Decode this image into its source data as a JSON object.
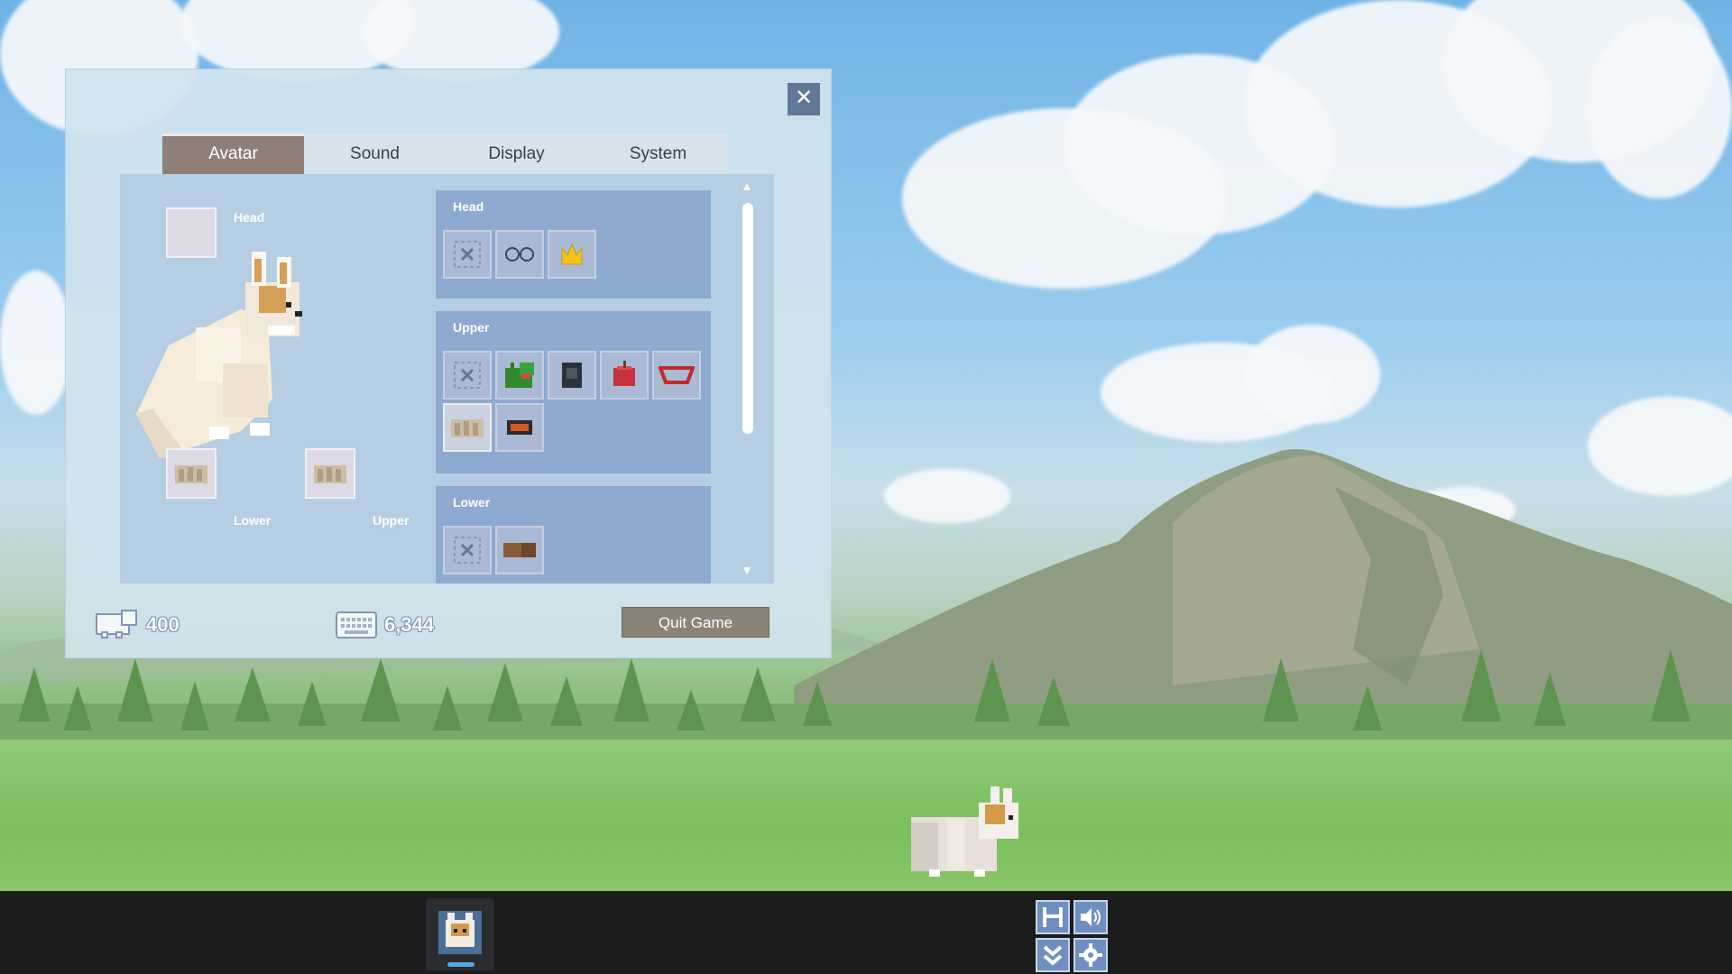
{
  "window": {
    "close_label": "✕"
  },
  "tabs": [
    {
      "label": "Avatar",
      "active": true
    },
    {
      "label": "Sound",
      "active": false
    },
    {
      "label": "Display",
      "active": false
    },
    {
      "label": "System",
      "active": false
    }
  ],
  "preview": {
    "head_label": "Head",
    "lower_label": "Lower",
    "upper_label": "Upper"
  },
  "categories": {
    "head": {
      "title": "Head",
      "items": [
        "none-icon",
        "glasses-icon",
        "crown-icon"
      ]
    },
    "upper": {
      "title": "Upper",
      "items": [
        "none-icon",
        "dino-hood-icon",
        "dark-hood-icon",
        "apple-icon",
        "red-visor-icon",
        "fluffy-coat-icon",
        "goggles-icon"
      ]
    },
    "lower": {
      "title": "Lower",
      "items": [
        "none-icon",
        "brown-pants-icon"
      ]
    }
  },
  "footer": {
    "sheep_count": "400",
    "keyboard_count": "6,344",
    "quit_label": "Quit Game"
  },
  "colors": {
    "panel_bg": "#d1e3ed",
    "active_tab": "#8f7f79",
    "category_bg": "#8faad0",
    "quit_button": "#8a8476",
    "taskbar": "#1b1c1e"
  }
}
